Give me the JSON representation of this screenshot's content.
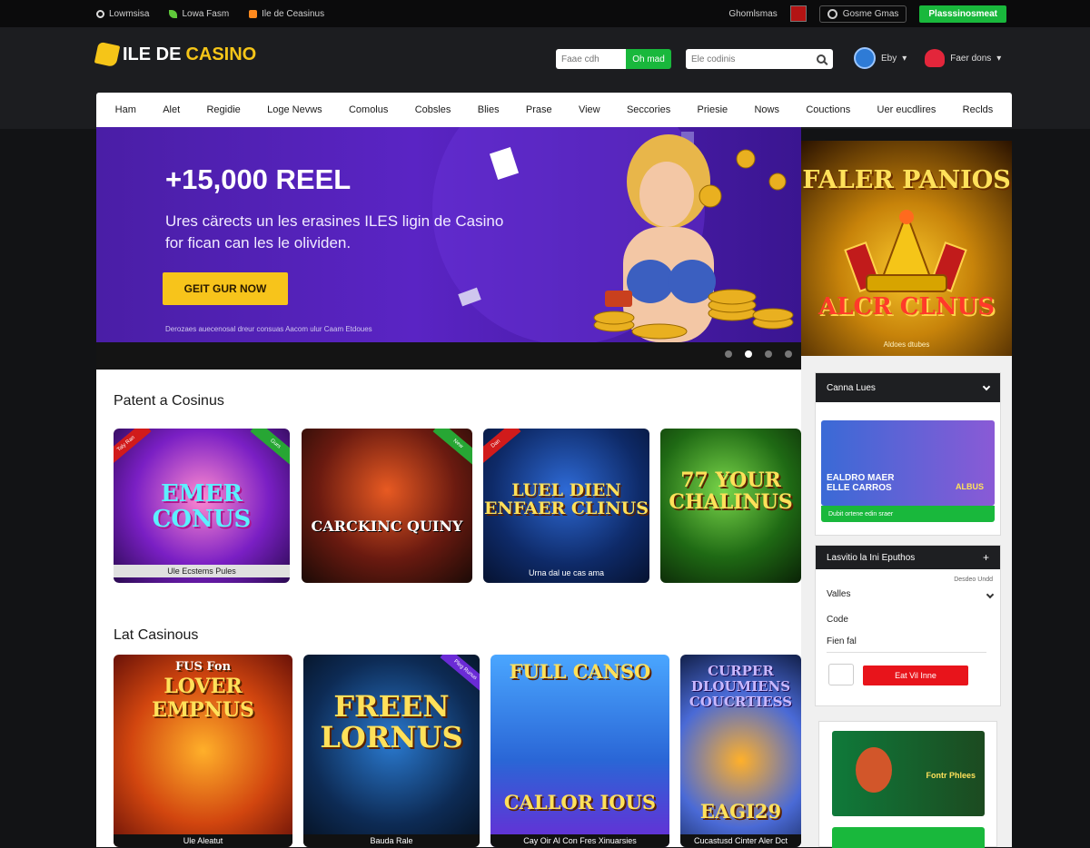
{
  "topbar": {
    "left_items": [
      "Lowmsisa",
      "Lowa Fasm",
      "Ile de Ceasinus"
    ],
    "right_link": "Ghomlsmas",
    "lang_label": "Gosme Gmas",
    "cta": "Plasssinosmeat"
  },
  "header": {
    "logo_white": "ILE DE",
    "logo_gold": "CASINO",
    "search1_placeholder": "Faae cdh",
    "search1_button": "Oh mad",
    "search2_placeholder": "Ele codinis",
    "account_label": "Eby",
    "favorites_label": "Faer dons"
  },
  "nav": [
    "Ham",
    "Alet",
    "Regidie",
    "Loge Nevws",
    "Comolus",
    "Cobsles",
    "Blies",
    "Prase",
    "View",
    "Seccories",
    "Priesie",
    "Nows",
    "Couctions",
    "Uer eucdlires",
    "Reclds"
  ],
  "hero": {
    "title": "+15,000 REEL",
    "subtitle": "Ures cärects un les erasines ILES ligin de Casino for fican can les le olividen.",
    "button": "GEIT GUR NOW",
    "small_text": "Derozaes auecenosal dreur consuas Aacom ulur Caam Etdoues"
  },
  "promo": {
    "title": "FALER PANIOS",
    "subtitle": "ALCR CLNUS",
    "footer": "Aldoes dtubes"
  },
  "sections": {
    "popular_title": "Patent a Cosinus",
    "latest_title": "Lat Casinous"
  },
  "popular_cards": [
    {
      "big": "EMER CONUS",
      "label": "Ule Ecstems Pules",
      "ribbon_left": "Taly Ran",
      "ribbon_right": "Gurs"
    },
    {
      "big": "CARCKINC QUINY",
      "label": "",
      "ribbon_right": "New"
    },
    {
      "big": "LUEL DIEN ENFAER CLINUS",
      "label": "Urna dal ue cas ama",
      "ribbon_left": "Dan"
    },
    {
      "big": "77 YOUR CHALINUS",
      "label": ""
    }
  ],
  "latest_cards": [
    {
      "big": "LOVER EMPNUS",
      "top": "FUS Fon",
      "label": "Ule Aleatut"
    },
    {
      "big": "FREEN LORNUS",
      "label": "Bauda Rale",
      "ribbon_right": "Pleg Runus"
    },
    {
      "big": "CALLOR IOUS",
      "top": "FULL CANSO",
      "label": "Cay Oir Al Con Fres Xinuarsies"
    },
    {
      "big": "EAGI29",
      "top": "CURPER DLOUMIENS COUCRTIESS",
      "label": "Cucastusd Cinter Aler Dct"
    }
  ],
  "sidebar": {
    "panel1_title": "Canna Lues",
    "panel1_card": "EALDRO MAER ELLE CARROS",
    "panel1_card_right": "ALBUS",
    "panel1_bar": "Dubit ortene edin sraer",
    "panel2_title": "Lasvitio la Ini Eputhos",
    "panel2_hint": "Desdeo Undd",
    "select_label": "Valles",
    "code_label": "Code",
    "email_label": "Fien fal",
    "submit": "Eat Vil Inne",
    "panel3_card": "Fontr Phlees"
  },
  "colors": {
    "accent_yellow": "#f7c41b",
    "accent_green": "#19b83c",
    "accent_red": "#e8141b",
    "hero_purple": "#5a24c4"
  }
}
